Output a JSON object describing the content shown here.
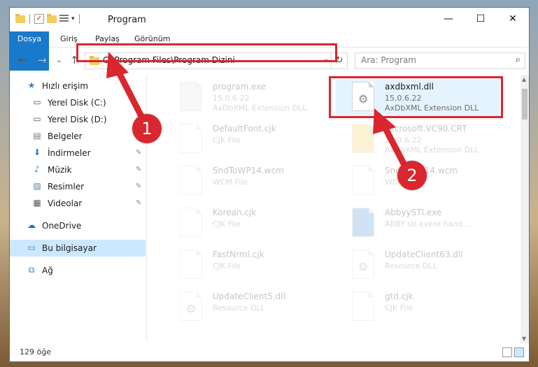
{
  "window": {
    "title": "Program"
  },
  "controls": {
    "minimize": "—",
    "maximize": "☐",
    "close": "✕"
  },
  "ribbon": {
    "tabs": [
      "Dosya",
      "Giriş",
      "Paylaş",
      "Görünüm"
    ]
  },
  "nav": {
    "back": "←",
    "forward": "→",
    "recent": "⌄",
    "up": "↑"
  },
  "address": {
    "path": "C:\\Program Files\\Program Dizini",
    "dropdown": "⌄",
    "refresh": "↻"
  },
  "search": {
    "placeholder": "Ara: Program",
    "icon": "⌕"
  },
  "sidebar": {
    "items": [
      {
        "label": "Hızlı erişim",
        "icon": "★"
      },
      {
        "label": "Yerel Disk (C:)",
        "icon": "▭"
      },
      {
        "label": "Yerel Disk (D:)",
        "icon": "▭"
      },
      {
        "label": "Belgeler",
        "icon": "▤"
      },
      {
        "label": "İndirmeler",
        "icon": "⬇"
      },
      {
        "label": "Müzik",
        "icon": "♪"
      },
      {
        "label": "Resimler",
        "icon": "▨"
      },
      {
        "label": "Videolar",
        "icon": "▦"
      },
      {
        "label": "OneDrive",
        "icon": "☁"
      },
      {
        "label": "Bu bilgisayar",
        "icon": "▭"
      },
      {
        "label": "Ağ",
        "icon": "⧉"
      }
    ],
    "pin": "📌"
  },
  "files": [
    {
      "name": "program.exe",
      "version": "15.0.6.22",
      "desc": "AxDbXML Extension DLL"
    },
    {
      "name": "axdbxml.dll",
      "version": "15.0.6.22",
      "desc": "AxDbXML Extension DLL"
    },
    {
      "name": "DefaultFont.cjk",
      "version": "CJK File",
      "desc": ""
    },
    {
      "name": "Microsoft.VC90.CRT",
      "version": "15.0.6.22",
      "desc": "AxDbXML Extension DLL"
    },
    {
      "name": "SndToWP14.wcm",
      "version": "WCM File",
      "desc": ""
    },
    {
      "name": "SndToFTP14.wcm",
      "version": "WCM File",
      "desc": ""
    },
    {
      "name": "Korean.cjk",
      "version": "CJK File",
      "desc": ""
    },
    {
      "name": "AbbyySTI.exe",
      "version": "ABBY sti event hand...",
      "desc": ""
    },
    {
      "name": "FastNrml.cjk",
      "version": "CJK File",
      "desc": ""
    },
    {
      "name": "UpdateClient63.dll",
      "version": "Resource DLL",
      "desc": ""
    },
    {
      "name": "UpdateClient5.dll",
      "version": "Resource DLL",
      "desc": ""
    },
    {
      "name": "gtd.cjk",
      "version": "CJK File",
      "desc": ""
    }
  ],
  "status": {
    "count": "129 öğe"
  },
  "annotations": {
    "step1": "1",
    "step2": "2",
    "color": "#d9262f"
  }
}
